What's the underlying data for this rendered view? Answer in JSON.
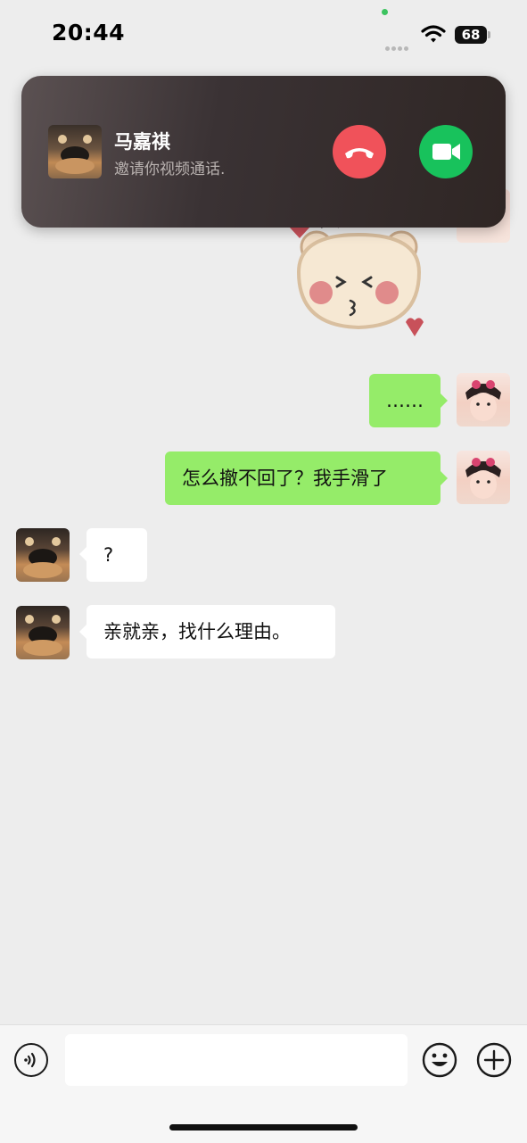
{
  "status_bar": {
    "time": "20:44",
    "battery": "68",
    "icons": [
      "signal-dots-icon",
      "wifi-icon",
      "battery-icon"
    ]
  },
  "incoming_call": {
    "caller_name": "马嘉祺",
    "subtitle": "邀请你视频通话.",
    "decline_icon": "phone-hangup-icon",
    "accept_icon": "video-camera-icon",
    "colors": {
      "decline": "#f0525a",
      "accept": "#18c25c"
    }
  },
  "chat": {
    "sticker": {
      "icon": "kissing-bear-sticker"
    },
    "messages": [
      {
        "side": "out",
        "text": "……"
      },
      {
        "side": "out",
        "text": "怎么撤不回了？我手滑了"
      },
      {
        "side": "in",
        "text": "?"
      },
      {
        "side": "in",
        "text": "亲就亲，找什么理由。"
      }
    ],
    "colors": {
      "outgoing_bubble": "#95ec69",
      "incoming_bubble": "#ffffff",
      "background": "#ededed"
    }
  },
  "input_bar": {
    "value": "",
    "icons": [
      "voice-icon",
      "emoji-icon",
      "plus-icon"
    ]
  }
}
